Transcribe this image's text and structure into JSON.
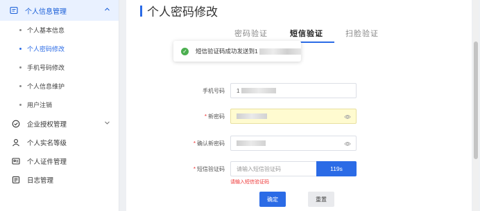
{
  "sidebar": {
    "group": {
      "label": "个人信息管理",
      "icon": "profile-card-icon",
      "chevron": "chevron-up-icon"
    },
    "sub_items": [
      {
        "label": "个人基本信息",
        "active": false
      },
      {
        "label": "个人密码修改",
        "active": true
      },
      {
        "label": "手机号码修改",
        "active": false
      },
      {
        "label": "个人信息维护",
        "active": false
      },
      {
        "label": "用户注销",
        "active": false
      }
    ],
    "items": [
      {
        "label": "企业授权管理",
        "icon": "shield-check-icon",
        "has_chevron": true
      },
      {
        "label": "个人实名等级",
        "icon": "user-icon",
        "has_chevron": false
      },
      {
        "label": "个人证件管理",
        "icon": "id-card-icon",
        "has_chevron": false
      },
      {
        "label": "日志管理",
        "icon": "log-icon",
        "has_chevron": false
      }
    ]
  },
  "page": {
    "title": "个人密码修改",
    "tabs": [
      {
        "label": "密码验证",
        "active": false
      },
      {
        "label": "短信验证",
        "active": true
      },
      {
        "label": "扫脸验证",
        "active": false
      }
    ]
  },
  "toast": {
    "message": "短信验证码成功发送到1",
    "icon": "check-circle-icon"
  },
  "form": {
    "phone": {
      "label": "手机号码",
      "value_prefix": "1"
    },
    "new_password": {
      "label": "新密码",
      "required": true
    },
    "confirm_password": {
      "label": "确认新密码",
      "required": true
    },
    "sms_code": {
      "label": "短信验证码",
      "required": true,
      "placeholder": "请输入短信验证码",
      "button_label": "119s",
      "error": "请输入短信验证码"
    }
  },
  "actions": {
    "confirm": "确定",
    "reset": "重置"
  },
  "colors": {
    "accent": "#2b6be6",
    "error": "#e33333",
    "success": "#4caf50",
    "autofill": "#fffbd0"
  }
}
